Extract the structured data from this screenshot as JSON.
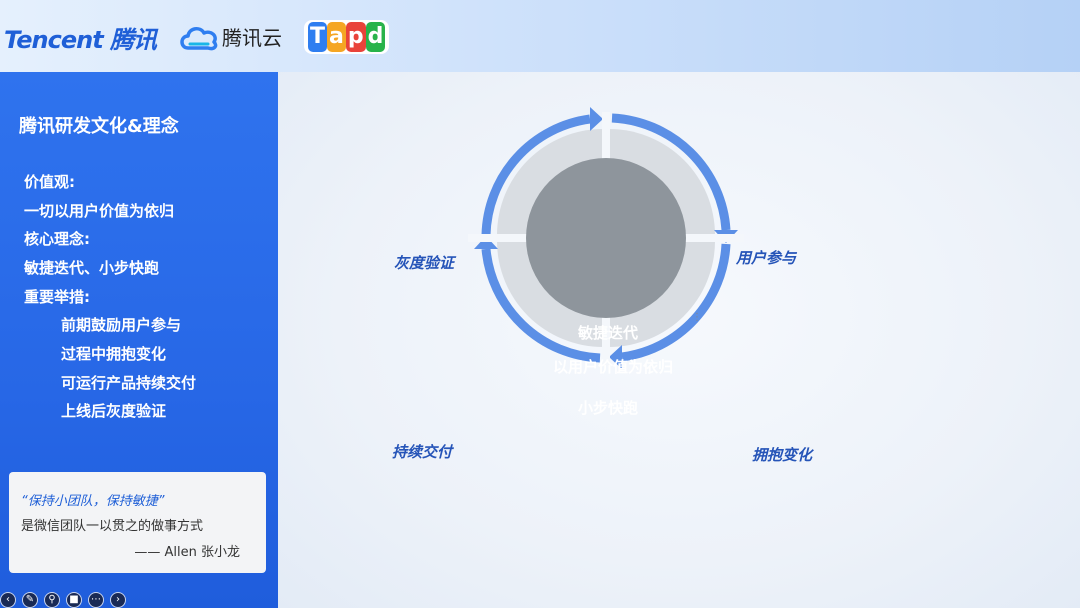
{
  "header": {
    "tencent_logo": "Tencent 腾讯",
    "cloud_logo_text": "腾讯云",
    "tapd_letters": [
      "T",
      "a",
      "p",
      "d"
    ],
    "tapd_colors": [
      "#2f7ef0",
      "#f5a623",
      "#e9433a",
      "#28b34a"
    ]
  },
  "sidebar": {
    "title": "腾讯研发文化&理念",
    "items": [
      "价值观:",
      "一切以用户价值为依归",
      "核心理念:",
      "敏捷迭代、小步快跑",
      "重要举措:",
      "前期鼓励用户参与",
      "过程中拥抱变化",
      "可运行产品持续交付",
      "上线后灰度验证"
    ],
    "quote": {
      "line1": "“保持小团队，保持敏捷”",
      "line2": "是微信团队一以贯之的做事方式",
      "line3": "—— Allen 张小龙"
    }
  },
  "toolbar": {
    "icons": [
      "prev-icon",
      "pen-icon",
      "zoom-icon",
      "camera-icon",
      "more-icon",
      "next-icon"
    ]
  },
  "diagram": {
    "labels": {
      "top_left": "灰度验证",
      "top_right": "用户参与",
      "bottom_right": "拥抱变化",
      "bottom_left": "持续交付"
    },
    "center": {
      "line1": "敏捷迭代",
      "line2": "以用户价值为依归",
      "line3": "小步快跑"
    },
    "colors": {
      "arrow": "#5b8fe6",
      "center": "#8e959c",
      "segment": "#d9dde2"
    }
  }
}
